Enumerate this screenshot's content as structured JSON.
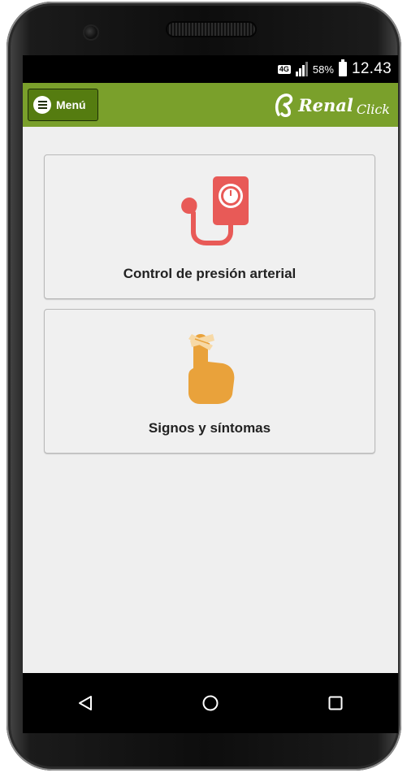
{
  "status_bar": {
    "network": "4G",
    "battery_percent": "58%",
    "time": "12.43"
  },
  "app_bar": {
    "menu_label": "Menú",
    "logo_text": "Renal",
    "logo_subtext": "Click"
  },
  "cards": [
    {
      "label": "Control de presión arterial",
      "icon": "blood-pressure-monitor-icon",
      "color": "#e85a57"
    },
    {
      "label": "Signos y síntomas",
      "icon": "bandaged-finger-icon",
      "color": "#e9a23b"
    }
  ],
  "colors": {
    "app_bar": "#7aa02b",
    "menu_button": "#557c10",
    "background": "#efefef"
  }
}
